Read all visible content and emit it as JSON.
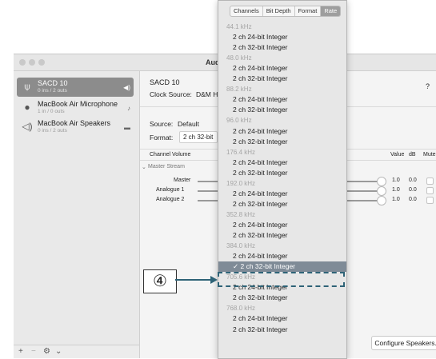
{
  "window": {
    "title": "Aud",
    "sidebar": {
      "devices": [
        {
          "name": "SACD 10",
          "sub": "0 ins / 2 outs",
          "icon": "usb-icon",
          "side": "◀)",
          "selected": true
        },
        {
          "name": "MacBook Air Microphone",
          "sub": "1 in / 0 outs",
          "icon": "microphone-icon",
          "side": "🎙",
          "selected": false
        },
        {
          "name": "MacBook Air Speakers",
          "sub": "0 ins / 2 outs",
          "icon": "speaker-icon",
          "side": "▬",
          "selected": false
        }
      ],
      "bottom_buttons": [
        "+",
        "−",
        "⚙",
        "⌄"
      ]
    },
    "detail": {
      "device_name": "SACD 10",
      "clock_source_label": "Clock Source:",
      "clock_source_value": "D&M H",
      "help": "?",
      "source_label": "Source:",
      "source_value": "Default",
      "format_label": "Format:",
      "format_value": "2 ch 32-bit",
      "columns": {
        "channel_volume": "Channel Volume",
        "value": "Value",
        "db": "dB",
        "mute": "Mute"
      },
      "master_stream": "Master Stream",
      "channels": [
        {
          "name": "Master",
          "value": "1.0",
          "db": "0.0",
          "level": 1.0
        },
        {
          "name": "Analogue 1",
          "value": "1.0",
          "db": "0.0",
          "level": 1.0
        },
        {
          "name": "Analogue 2",
          "value": "1.0",
          "db": "0.0",
          "level": 1.0
        }
      ],
      "configure_speakers": "Configure Speakers..."
    }
  },
  "menu": {
    "tabs": [
      {
        "label": "Channels",
        "active": false
      },
      {
        "label": "Bit Depth",
        "active": false
      },
      {
        "label": "Format",
        "active": false
      },
      {
        "label": "Rate",
        "active": true
      }
    ],
    "items": [
      {
        "kind": "header",
        "text": "44.1 kHz"
      },
      {
        "kind": "option",
        "text": "2 ch 24-bit Integer"
      },
      {
        "kind": "option",
        "text": "2 ch 32-bit Integer"
      },
      {
        "kind": "header",
        "text": "48.0 kHz"
      },
      {
        "kind": "option",
        "text": "2 ch 24-bit Integer"
      },
      {
        "kind": "option",
        "text": "2 ch 32-bit Integer"
      },
      {
        "kind": "header",
        "text": "88.2 kHz"
      },
      {
        "kind": "option",
        "text": "2 ch 24-bit Integer"
      },
      {
        "kind": "option",
        "text": "2 ch 32-bit Integer"
      },
      {
        "kind": "header",
        "text": "96.0 kHz"
      },
      {
        "kind": "option",
        "text": "2 ch 24-bit Integer"
      },
      {
        "kind": "option",
        "text": "2 ch 32-bit Integer"
      },
      {
        "kind": "header",
        "text": "176.4 kHz"
      },
      {
        "kind": "option",
        "text": "2 ch 24-bit Integer"
      },
      {
        "kind": "option",
        "text": "2 ch 32-bit Integer"
      },
      {
        "kind": "header",
        "text": "192.0 kHz"
      },
      {
        "kind": "option",
        "text": "2 ch 24-bit Integer"
      },
      {
        "kind": "option",
        "text": "2 ch 32-bit Integer"
      },
      {
        "kind": "header",
        "text": "352.8 kHz"
      },
      {
        "kind": "option",
        "text": "2 ch 24-bit Integer"
      },
      {
        "kind": "option",
        "text": "2 ch 32-bit Integer"
      },
      {
        "kind": "header",
        "text": "384.0 kHz"
      },
      {
        "kind": "option",
        "text": "2 ch 24-bit Integer"
      },
      {
        "kind": "option",
        "text": "✓ 2 ch 32-bit Integer",
        "selected": true
      },
      {
        "kind": "header",
        "text": "705.6 kHz"
      },
      {
        "kind": "option",
        "text": "2 ch 24-bit Integer"
      },
      {
        "kind": "option",
        "text": "2 ch 32-bit Integer"
      },
      {
        "kind": "header",
        "text": "768.0 kHz"
      },
      {
        "kind": "option",
        "text": "2 ch 24-bit Integer"
      },
      {
        "kind": "option",
        "text": "2 ch 32-bit Integer"
      }
    ]
  },
  "annotation": {
    "callout": "④"
  },
  "colors": {
    "selected_item": "#7f8b97",
    "callout_accent": "#2e6377"
  }
}
